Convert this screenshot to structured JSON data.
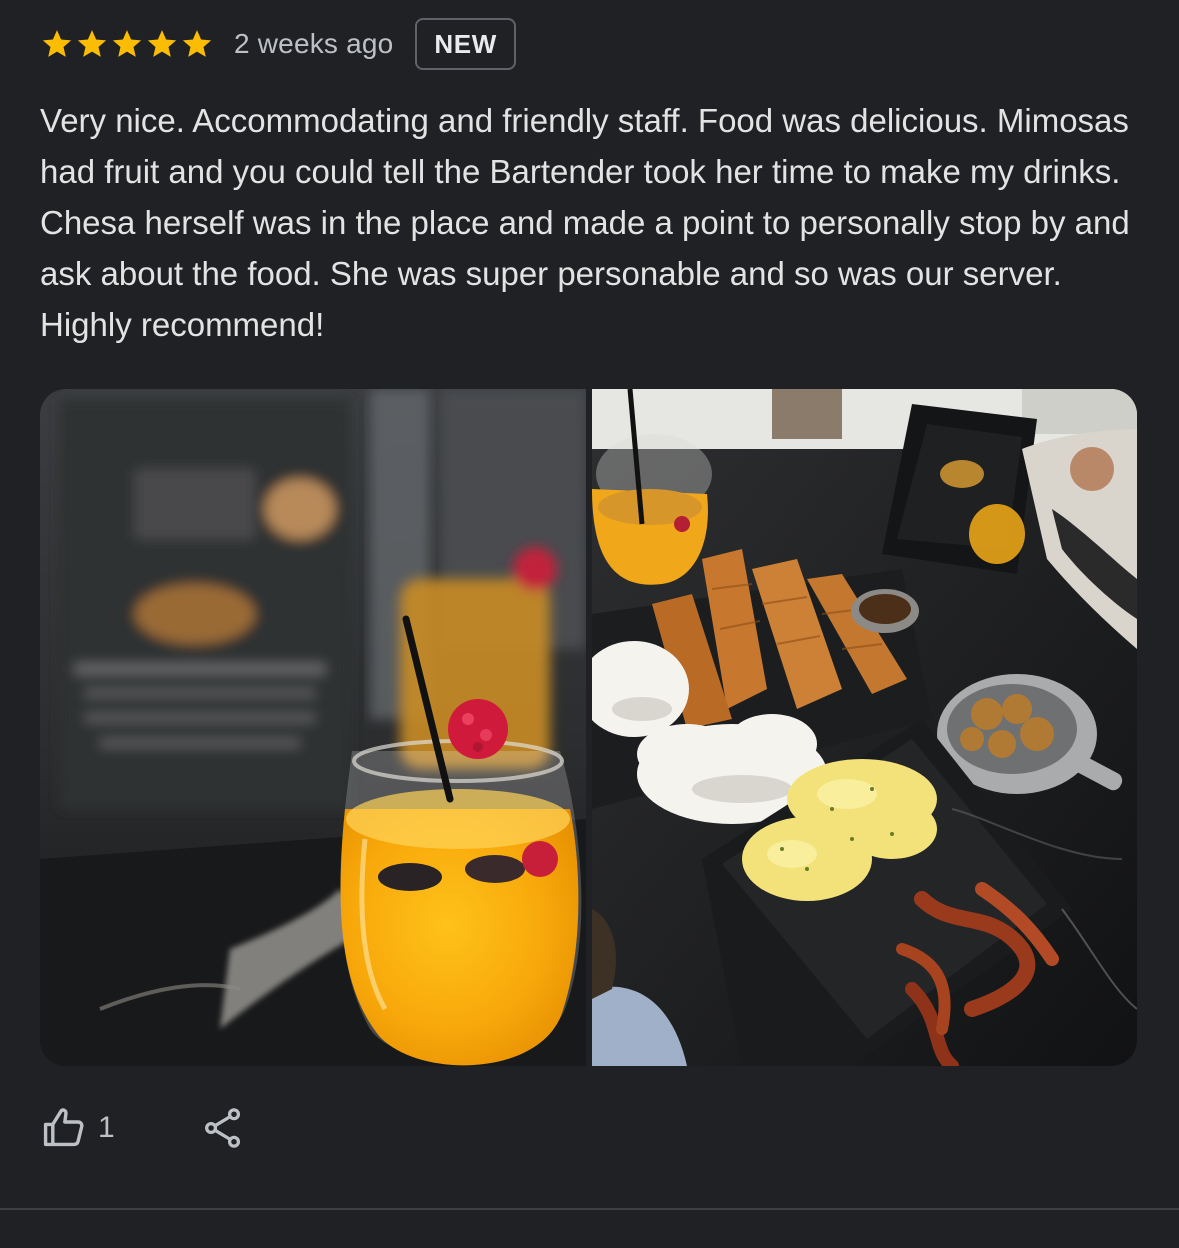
{
  "review": {
    "rating": 5,
    "rating_max": 5,
    "date": "2 weeks ago",
    "badge": "NEW",
    "text": "Very nice. Accommodating and friendly staff. Food was delicious. Mimosas had fruit and you could tell the Bartender took her time to make my drinks. Chesa herself was in the place and made a point to personally stop by and ask about the food. She was super personable and so was our server. Highly recommend!",
    "photos": [
      {
        "subject": "mimosa-with-raspberry-photo"
      },
      {
        "subject": "breakfast-platter-photo"
      }
    ]
  },
  "actions": {
    "like_count": "1",
    "like_icon": "thumbs-up-icon",
    "share_icon": "share-icon"
  },
  "colors": {
    "background": "#202124",
    "star": "#fbbc04",
    "text": "#e3e3e3",
    "muted": "#bdc1c6",
    "badge_border": "#5f6368"
  }
}
